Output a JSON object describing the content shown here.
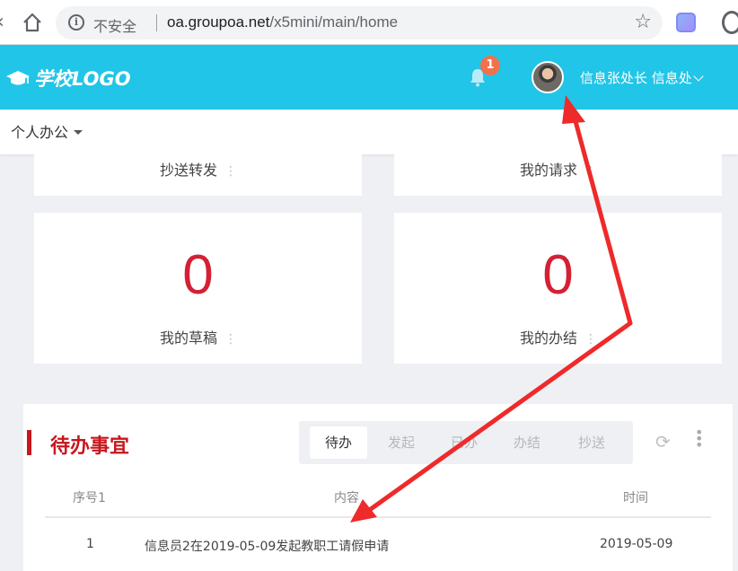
{
  "browser": {
    "security_label": "不安全",
    "url_host": "oa.groupoa.net",
    "url_path": "/x5mini/main/home"
  },
  "header": {
    "logo_text": "学校LOGO",
    "notification_count": "1",
    "user_label": "信息张处长 信息处"
  },
  "subnav": {
    "menu_label": "个人办公"
  },
  "cards": {
    "cc_forward": {
      "label": "抄送转发"
    },
    "my_requests": {
      "label": "我的请求"
    },
    "my_drafts": {
      "label": "我的草稿",
      "count": "0"
    },
    "my_completed": {
      "label": "我的办结",
      "count": "0"
    }
  },
  "todo": {
    "title": "待办事宜",
    "tabs": [
      "待办",
      "发起",
      "已办",
      "办结",
      "抄送"
    ],
    "active_tab": "待办",
    "columns": [
      "序号1",
      "内容",
      "时间"
    ],
    "rows": [
      {
        "index": "1",
        "content": "信息员2在2019-05-09发起教职工请假申请",
        "date": "2019-05-09"
      }
    ]
  },
  "colors": {
    "header_bg": "#21c5e7",
    "accent_red": "#c8161d",
    "number_red": "#d42035",
    "annotation_arrow": "#ee2a2a"
  }
}
